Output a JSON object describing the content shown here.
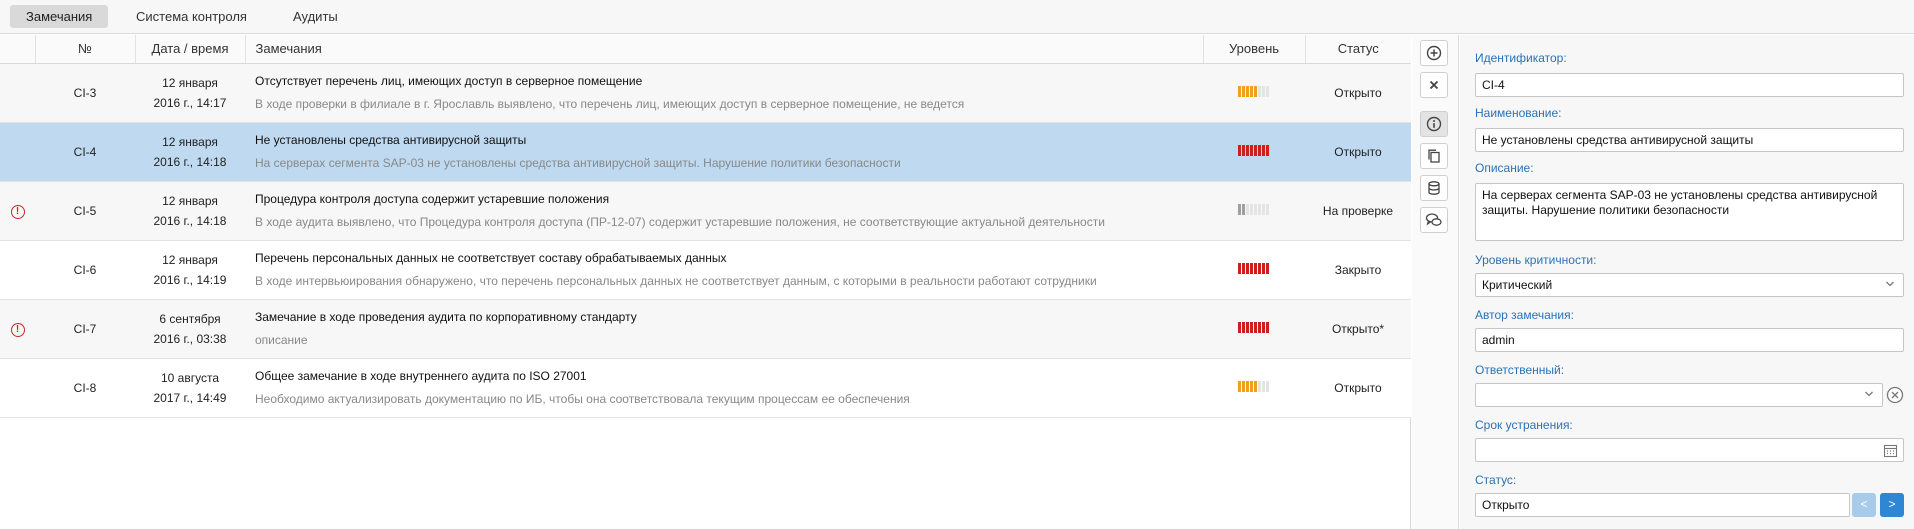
{
  "tabs": [
    {
      "label": "Замечания"
    },
    {
      "label": "Система контроля"
    },
    {
      "label": "Аудиты"
    }
  ],
  "table": {
    "headers": {
      "no": "№",
      "datetime": "Дата / время",
      "desc": "Замечания",
      "level": "Уровень",
      "status": "Статус"
    },
    "rows": [
      {
        "id": "CI-3",
        "date1": "12 января",
        "date2": "2016 г., 14:17",
        "title": "Отсутствует перечень лиц, имеющих доступ в серверное помещение",
        "desc": "В ходе проверки в филиале в г. Ярославль выявлено, что перечень лиц, имеющих доступ в серверное помещение, не ведется",
        "status": "Открыто",
        "level": 5,
        "level_color": "#f0a020",
        "alert": false
      },
      {
        "id": "CI-4",
        "date1": "12 января",
        "date2": "2016 г., 14:18",
        "title": "Не установлены средства антивирусной защиты",
        "desc": "На серверах сегмента SAP-03 не установлены средства антивирусной защиты. Нарушение политики безопасности",
        "status": "Открыто",
        "level": 8,
        "level_color": "#cc1f1f",
        "alert": false
      },
      {
        "id": "CI-5",
        "date1": "12 января",
        "date2": "2016 г., 14:18",
        "title": "Процедура контроля доступа содержит устаревшие положения",
        "desc": "В ходе аудита выявлено, что Процедура контроля доступа (ПР-12-07) содержит устаревшие положения, не соответствующие актуальной деятельности",
        "status": "На проверке",
        "level": 2,
        "level_color": "#a0a0a0",
        "alert": true
      },
      {
        "id": "CI-6",
        "date1": "12 января",
        "date2": "2016 г., 14:19",
        "title": "Перечень персональных данных не соответствует составу обрабатываемых данных",
        "desc": "В ходе интервьюирования обнаружено, что перечень персональных данных не соответствует данным, с которыми в реальности работают сотрудники",
        "status": "Закрыто",
        "level": 8,
        "level_color": "#cc1f1f",
        "alert": false
      },
      {
        "id": "CI-7",
        "date1": "6 сентября",
        "date2": "2016 г., 03:38",
        "title": "Замечание в ходе проведения аудита по корпоративному стандарту",
        "desc": "описание",
        "status": "Открыто*",
        "level": 8,
        "level_color": "#cc1f1f",
        "alert": true
      },
      {
        "id": "CI-8",
        "date1": "10 августа",
        "date2": "2017 г., 14:49",
        "title": "Общее замечание в ходе внутреннего аудита по ISO 27001",
        "desc": "Необходимо актуализировать документацию по ИБ, чтобы она соответствовала текущим процессам ее обеспечения",
        "status": "Открыто",
        "level": 5,
        "level_color": "#f0a020",
        "alert": false
      }
    ],
    "selected_index": 1,
    "level_max": 8
  },
  "toolbar": {
    "icons": [
      "plus-circle-icon",
      "close-icon",
      "info-icon",
      "copy-icon",
      "database-icon",
      "comments-icon"
    ]
  },
  "form": {
    "id_label": "Идентификатор:",
    "id_value": "CI-4",
    "name_label": "Наименование:",
    "name_value": "Не установлены средства антивирусной защиты",
    "desc_label": "Описание:",
    "desc_value": "На серверах сегмента SAP-03 не установлены средства антивирусной защиты. Нарушение политики безопасности",
    "level_label": "Уровень критичности:",
    "level_value": "Критический",
    "author_label": "Автор замечания:",
    "author_value": "admin",
    "resp_label": "Ответственный:",
    "resp_value": "",
    "deadline_label": "Срок устранения:",
    "deadline_value": "",
    "status_label": "Статус:",
    "status_value": "Открыто",
    "prev_label": "<",
    "next_label": ">"
  },
  "colors": {
    "accent": "#2a72b5",
    "selected_row": "#bfdaf0",
    "alert": "#c62828",
    "nav_disabled": "#a9cbea",
    "nav_active": "#2f86d4"
  }
}
